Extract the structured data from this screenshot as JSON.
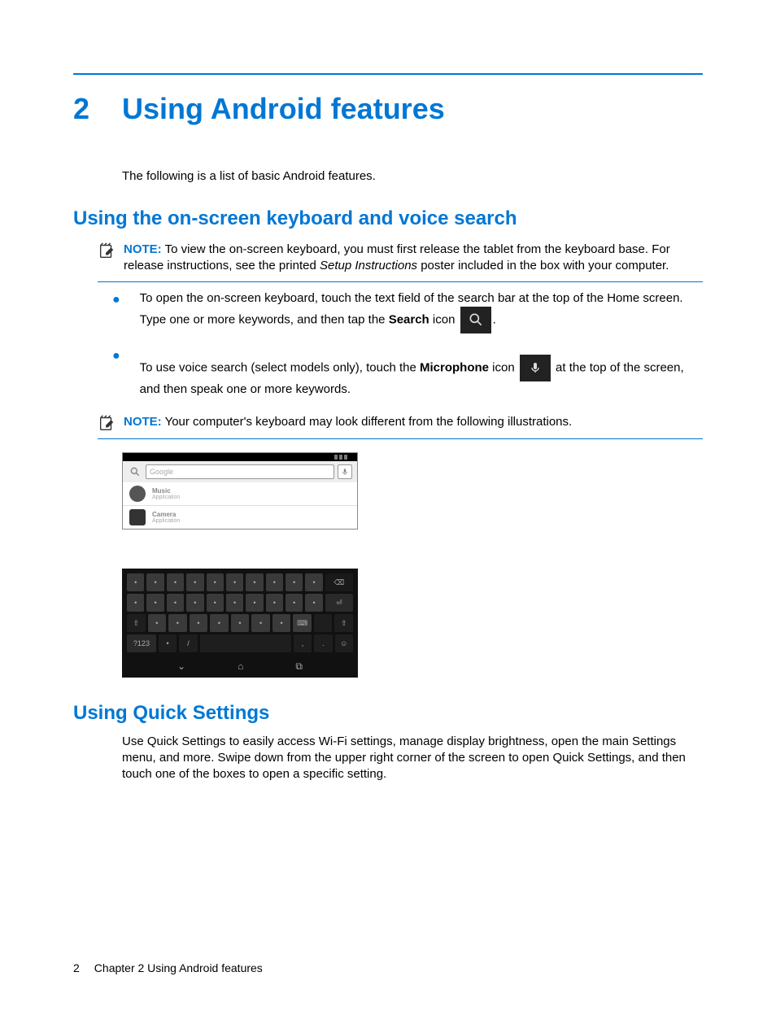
{
  "chapter": {
    "number": "2",
    "title": "Using Android features"
  },
  "intro": "The following is a list of basic Android features.",
  "section_keyboard": {
    "heading": "Using the on-screen keyboard and voice search",
    "note1_label": "NOTE:",
    "note1_text_a": "To view the on-screen keyboard, you must first release the tablet from the keyboard base. For release instructions, see the printed ",
    "note1_em": "Setup Instructions",
    "note1_text_b": " poster included in the box with your computer.",
    "bullet1_a": "To open the on-screen keyboard, touch the text field of the search bar at the top of the Home screen. Type one or more keywords, and then tap the ",
    "bullet1_bold": "Search",
    "bullet1_b": " icon ",
    "bullet1_c": ".",
    "bullet2_a": "To use voice search (select models only), touch the ",
    "bullet2_bold": "Microphone",
    "bullet2_b": " icon ",
    "bullet2_c": " at the top of the screen, and then speak one or more keywords.",
    "note2_label": "NOTE:",
    "note2_text": "Your computer's keyboard may look different from the following illustrations."
  },
  "search_shot": {
    "placeholder": "Google",
    "item1_title": "Music",
    "item1_sub": "Application",
    "item2_title": "Camera",
    "item2_sub": "Application"
  },
  "section_quick": {
    "heading": "Using Quick Settings",
    "body": "Use Quick Settings to easily access Wi-Fi settings, manage display brightness, open the main Settings menu, and more. Swipe down from the upper right corner of the screen to open Quick Settings, and then touch one of the boxes to open a specific setting."
  },
  "footer": {
    "page": "2",
    "label": "Chapter 2   Using Android features"
  }
}
